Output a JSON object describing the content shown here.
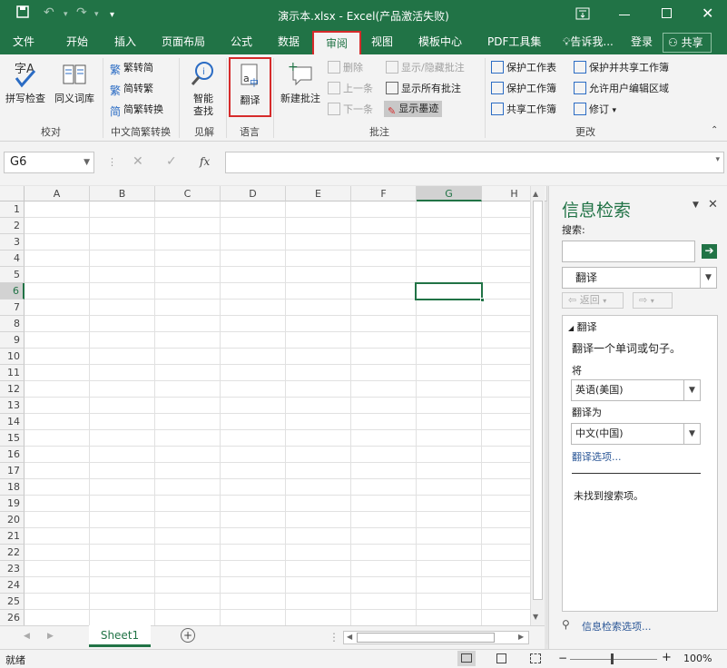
{
  "title": "演示本.xlsx - Excel(产品激活失败)",
  "colors": {
    "accent": "#217346",
    "highlight": "#d62b2b"
  },
  "tabs": [
    "文件",
    "开始",
    "插入",
    "页面布局",
    "公式",
    "数据",
    "审阅",
    "视图",
    "模板中心",
    "PDF工具集"
  ],
  "tell_me": "告诉我...",
  "login": "登录",
  "share": "共享",
  "ribbon": {
    "spell_check": "拼写检查",
    "thesaurus": "同义词库",
    "group_proofing": "校对",
    "trad_to_simp": "繁转简",
    "simp_to_trad": "简转繁",
    "convert": "简繁转换",
    "group_chinese": "中文简繁转换",
    "smart_lookup_1": "智能",
    "smart_lookup_2": "查找",
    "group_insights": "见解",
    "translate": "翻译",
    "group_language": "语言",
    "new_comment": "新建批注",
    "delete": "删除",
    "previous": "上一条",
    "next": "下一条",
    "show_hide_comment": "显示/隐藏批注",
    "show_all_comments": "显示所有批注",
    "show_ink": "显示墨迹",
    "group_comments": "批注",
    "protect_sheet": "保护工作表",
    "protect_workbook": "保护工作簿",
    "share_workbook": "共享工作簿",
    "protect_share": "保护并共享工作簿",
    "allow_edit": "允许用户编辑区域",
    "track_changes": "修订",
    "group_changes": "更改"
  },
  "name_box": "G6",
  "fx_label": "fx",
  "columns": [
    "A",
    "B",
    "C",
    "D",
    "E",
    "F",
    "G",
    "H"
  ],
  "rows": [
    "1",
    "2",
    "3",
    "4",
    "5",
    "6",
    "7",
    "8",
    "9",
    "10",
    "11",
    "12",
    "13",
    "14",
    "15",
    "16",
    "17",
    "18",
    "19",
    "20",
    "21",
    "22",
    "23",
    "24",
    "25",
    "26"
  ],
  "sheet_tab": "Sheet1",
  "status": {
    "ready": "就绪",
    "zoom": "100%"
  },
  "pane": {
    "title": "信息检索",
    "search_label": "搜索:",
    "source": "翻译",
    "back": "返回",
    "section": "翻译",
    "desc": "翻译一个单词或句子。",
    "from_label": "将",
    "from_value": "英语(美国)",
    "to_label": "翻译为",
    "to_value": "中文(中国)",
    "options_link": "翻译选项...",
    "no_results": "未找到搜索项。",
    "footer_link": "信息检索选项..."
  }
}
